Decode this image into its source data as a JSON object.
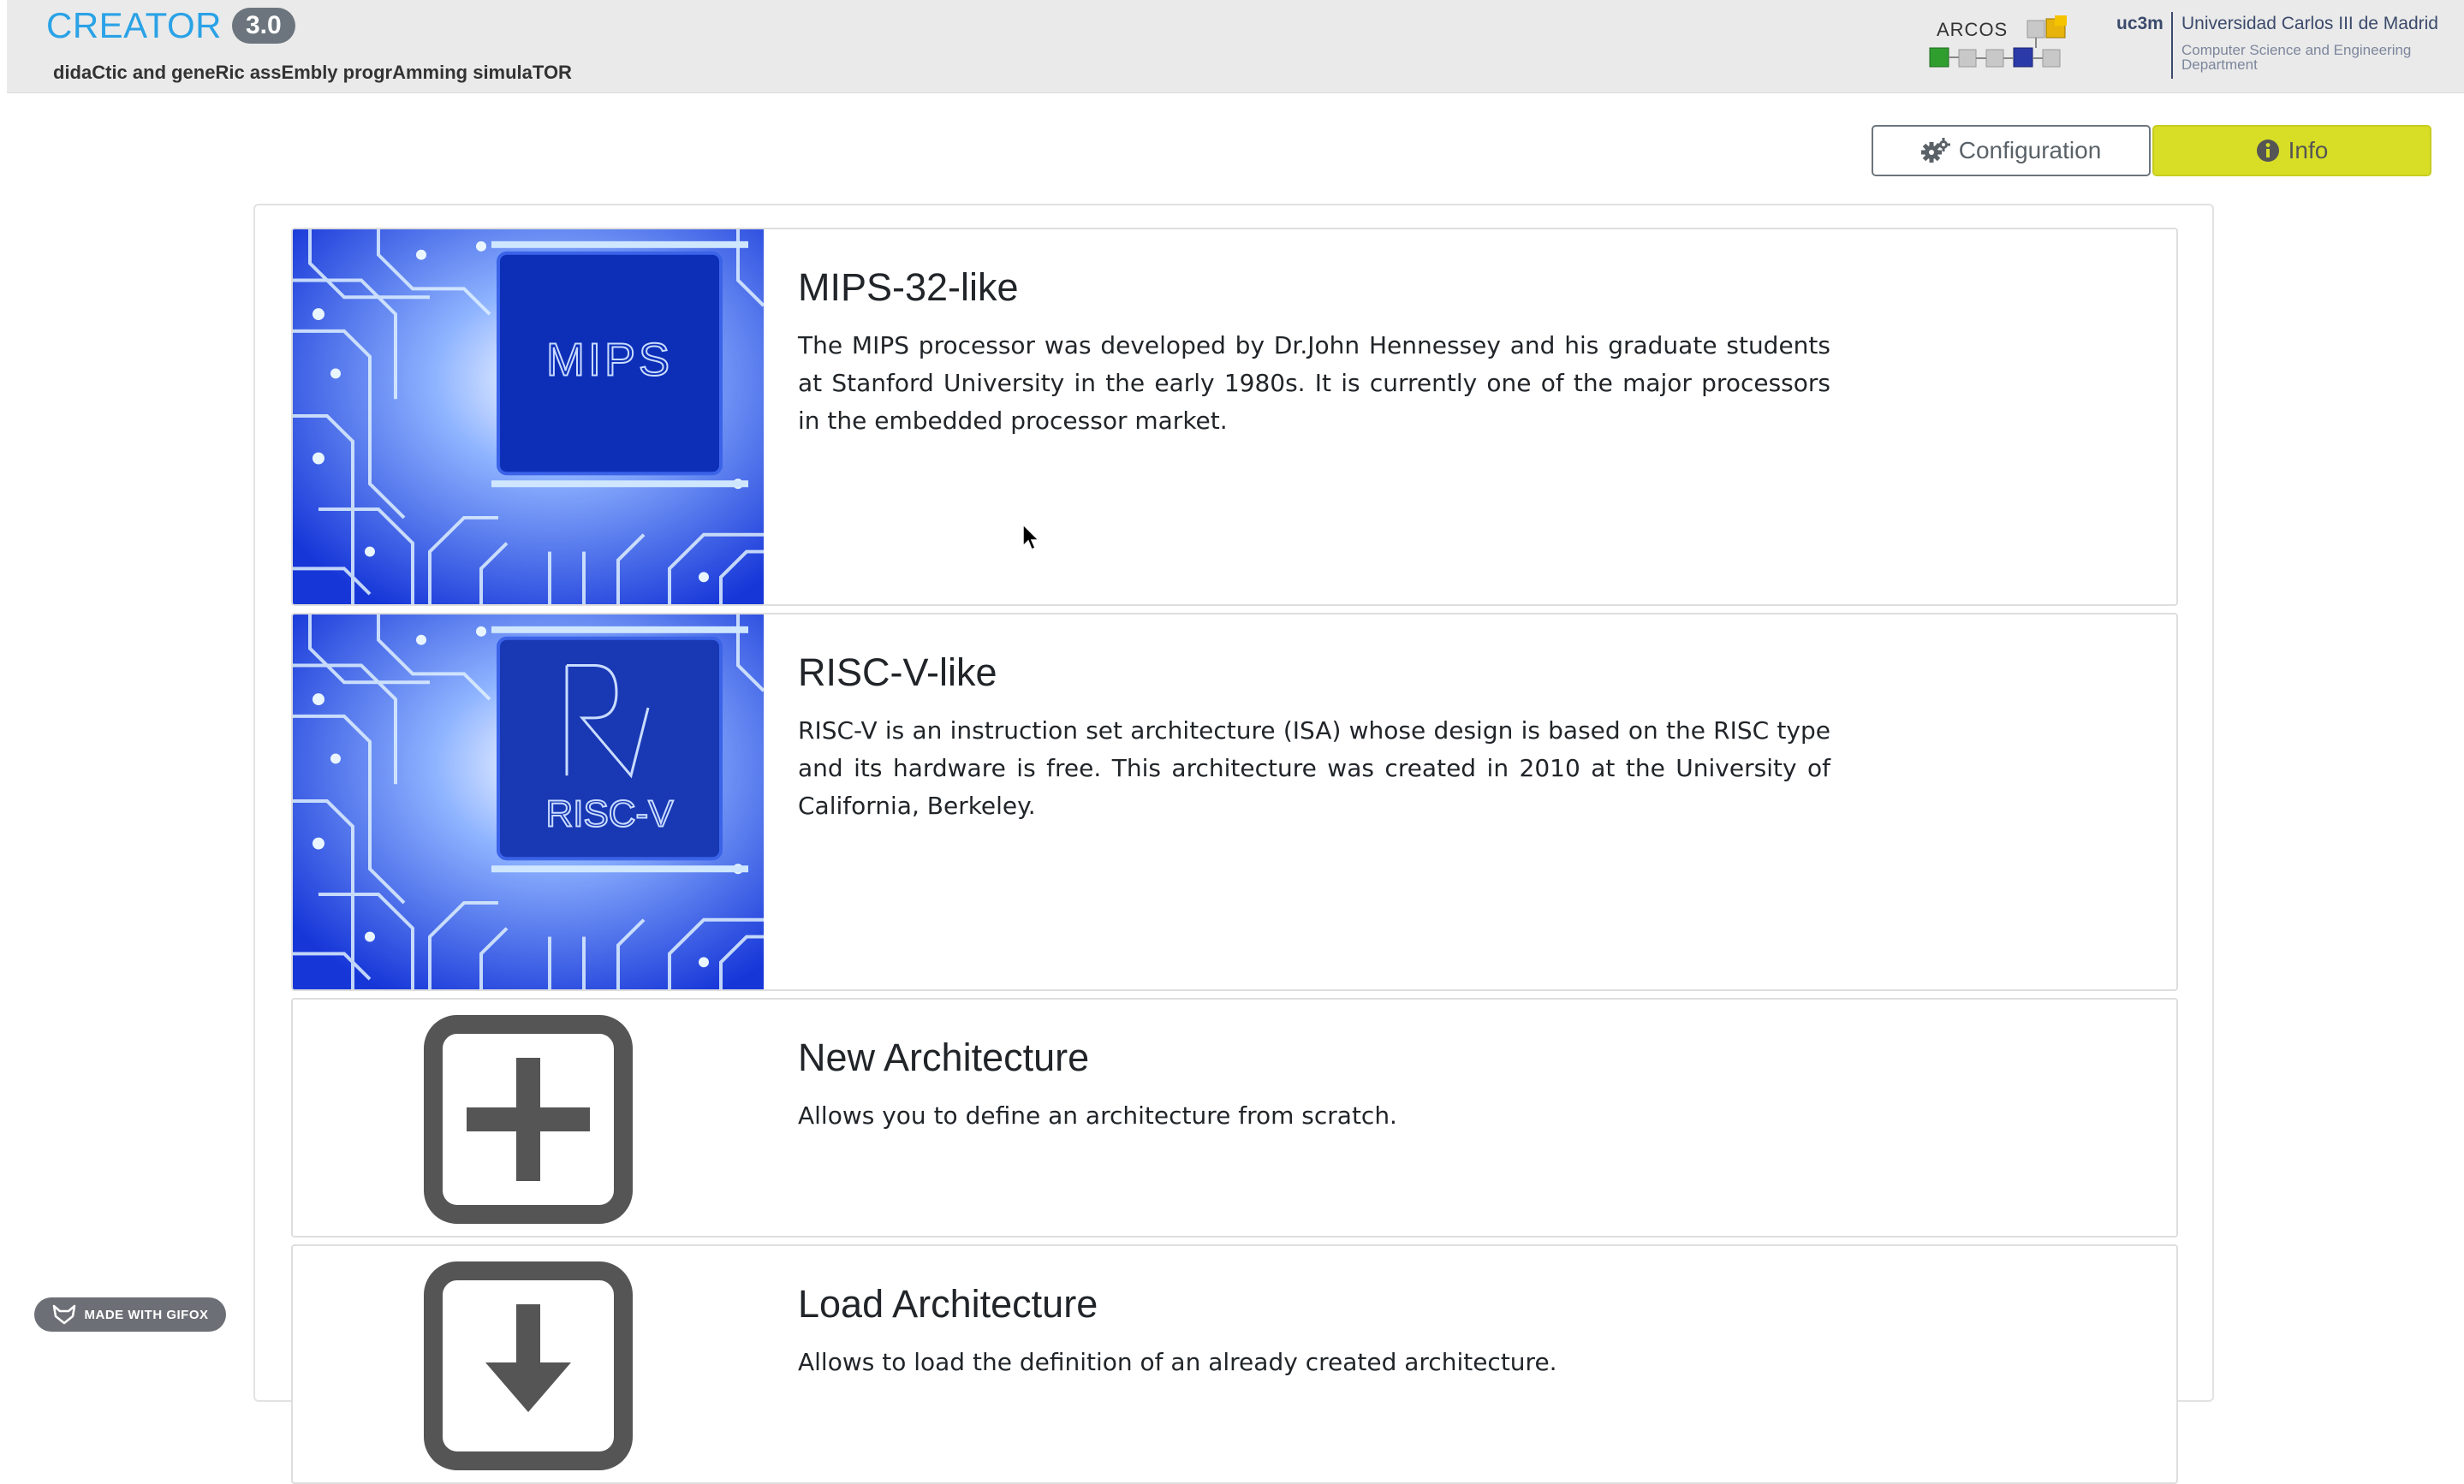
{
  "header": {
    "brand_name": "CREATOR",
    "version": "3.0",
    "subtitle": "didaCtic and geneRic assEmbly progrAmming simulaTOR",
    "arcos_logo_text": "ARCOS",
    "uc3m_short": "uc3m",
    "uc3m_name": "Universidad Carlos III de Madrid",
    "uc3m_department": "Computer Science and Engineering Department"
  },
  "toolbar": {
    "configuration_label": "Configuration",
    "info_label": "Info"
  },
  "architectures": [
    {
      "title": "MIPS-32-like",
      "description": "The MIPS processor was developed by Dr.John Hennessey and his graduate students at Stanford University in the early 1980s. It is currently one of the major processors in the embedded processor market.",
      "chip_label": "MIPS"
    },
    {
      "title": "RISC-V-like",
      "description": "RISC-V is an instruction set architecture (ISA) whose design is based on the RISC type and its hardware is free. This architecture was created in 2010 at the University of California, Berkeley.",
      "chip_label": "RISC-V"
    },
    {
      "title": "New Architecture",
      "description": "Allows you to define an architecture from scratch."
    },
    {
      "title": "Load Architecture",
      "description": "Allows to load the definition of an already created architecture."
    }
  ],
  "badge": {
    "gifox_label": "MADE WITH GIFOX"
  },
  "colors": {
    "brand_blue": "#2aa2e6",
    "info_button": "#d8de26",
    "header_bg": "#eaeaea",
    "version_badge": "#6c757d",
    "circuit_blue": "#1f3fe0"
  },
  "icons": {
    "config": "gears-icon",
    "info": "info-circle-icon",
    "new": "plus-square-icon",
    "load": "download-square-icon"
  }
}
